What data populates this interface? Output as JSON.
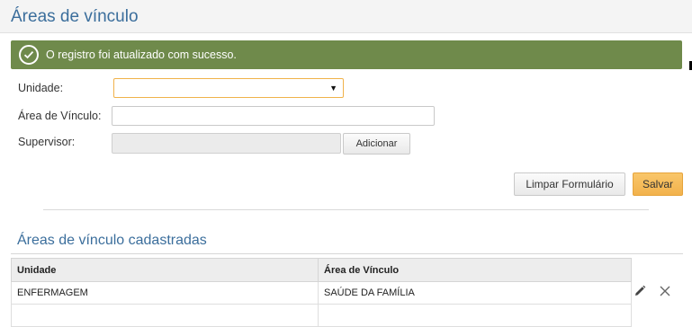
{
  "header": {
    "title": "Áreas de vínculo"
  },
  "alert": {
    "message": "O registro foi atualizado com sucesso."
  },
  "form": {
    "unidade_label": "Unidade:",
    "unidade_value": "",
    "area_label": "Área de Vínculo:",
    "area_value": "",
    "supervisor_label": "Supervisor:",
    "supervisor_value": "",
    "add_label": "Adicionar",
    "clear_label": "Limpar Formulário",
    "save_label": "Salvar"
  },
  "list": {
    "title": "Áreas de vínculo cadastradas",
    "columns": [
      "Unidade",
      "Área de Vínculo"
    ],
    "rows": [
      [
        "ENFERMAGEM",
        "SAÚDE DA FAMÍLIA"
      ]
    ]
  },
  "icons": {
    "success": "check-circle-icon",
    "edit": "pencil-icon",
    "delete": "close-icon"
  },
  "colors": {
    "title": "#3b6e9c",
    "alert_bg": "#6f8a4b",
    "save": "#f2b24c",
    "select_border": "#f0b24a"
  }
}
